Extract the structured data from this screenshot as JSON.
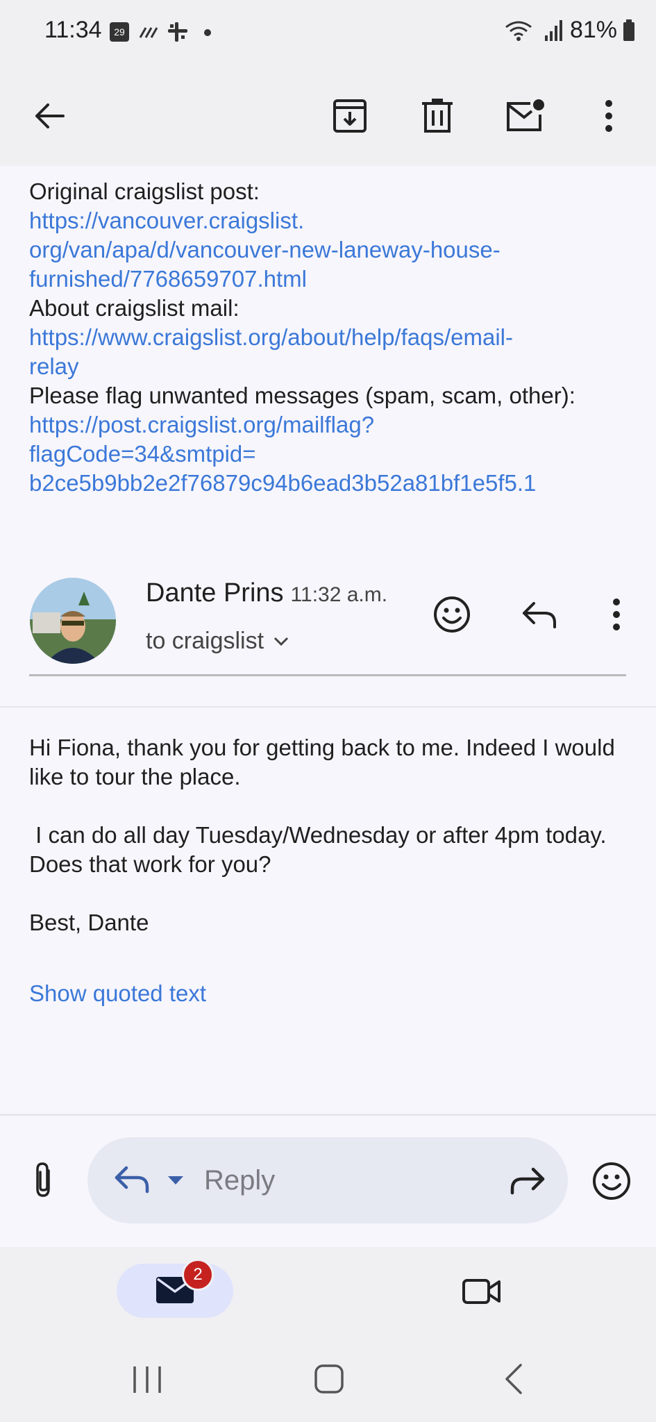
{
  "status_bar": {
    "time": "11:34",
    "calendar_day": "29",
    "battery": "81%"
  },
  "app_bar": {
    "icons": [
      "back-arrow-icon",
      "archive-icon",
      "delete-icon",
      "mark-unread-icon",
      "more-vert-icon"
    ]
  },
  "previous_message": {
    "lines": [
      {
        "type": "plain",
        "text": "Original craigslist post:"
      },
      {
        "type": "link",
        "text": "https://vancouver.craigslist."
      },
      {
        "type": "link",
        "text": "org/van/apa/d/vancouver-new-laneway-house-"
      },
      {
        "type": "link",
        "text": "furnished/7768659707.html"
      },
      {
        "type": "plain",
        "text": "About craigslist mail:"
      },
      {
        "type": "link",
        "text": "https://www.craigslist.org/about/help/faqs/email-"
      },
      {
        "type": "link",
        "text": "relay"
      },
      {
        "type": "plain",
        "text": "Please flag unwanted messages (spam, scam, other):"
      },
      {
        "type": "link",
        "text": "https://post.craigslist.org/mailflag?"
      },
      {
        "type": "link",
        "text": "flagCode=34&smtpid="
      },
      {
        "type": "link",
        "text": "b2ce5b9bb2e2f76879c94b6ead3b52a81bf1e5f5.1"
      }
    ]
  },
  "message": {
    "sender": "Dante Prins",
    "time": "11:32 a.m.",
    "recipient": "to craigslist",
    "body": [
      "Hi Fiona, thank you for getting back to me. Indeed I would like to tour the place.",
      " I can do all day Tuesday/Wednesday or after 4pm today. Does that work for you?",
      "Best, Dante"
    ],
    "show_quoted": "Show quoted text"
  },
  "reply_bar": {
    "placeholder": "Reply"
  },
  "bottom_nav": {
    "mail_badge": "2"
  },
  "colors": {
    "link": "#3b78d8",
    "badge": "#c5221f",
    "accent_pill": "#dfe3fb"
  }
}
